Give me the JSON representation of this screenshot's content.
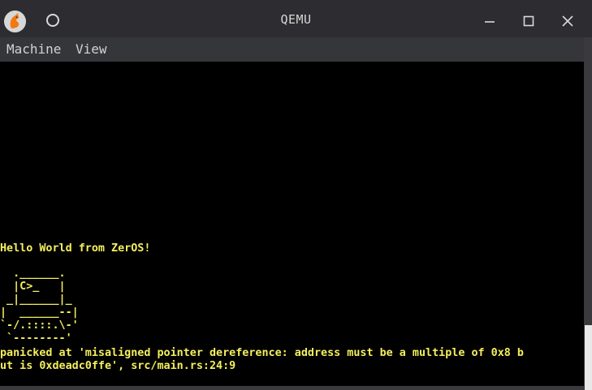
{
  "window": {
    "title": "QEMU"
  },
  "menu": {
    "items": [
      {
        "label": "Machine"
      },
      {
        "label": "View"
      }
    ]
  },
  "screen": {
    "hello": "Hello World from ZerOS!",
    "art": [
      "  .______.",
      "  |C>_   |",
      " _|______|_",
      "|  ______--|",
      "`-/.::::.\\-'",
      " `--------'"
    ],
    "panic_lines": [
      "panicked at 'misaligned pointer dereference: address must be a multiple of 0x8 b",
      "ut is 0xdeadc0ffe', src/main.rs:24:9"
    ]
  },
  "colors": {
    "text": "#f4ef5f",
    "screen_bg": "#000000",
    "titlebar_bg": "#2d2d31",
    "menubar_bg": "#35363a"
  },
  "icons": {
    "app": "qemu-logo-icon",
    "circle": "circle-icon",
    "minimize": "minimize-icon",
    "maximize": "maximize-icon",
    "close": "close-icon"
  }
}
